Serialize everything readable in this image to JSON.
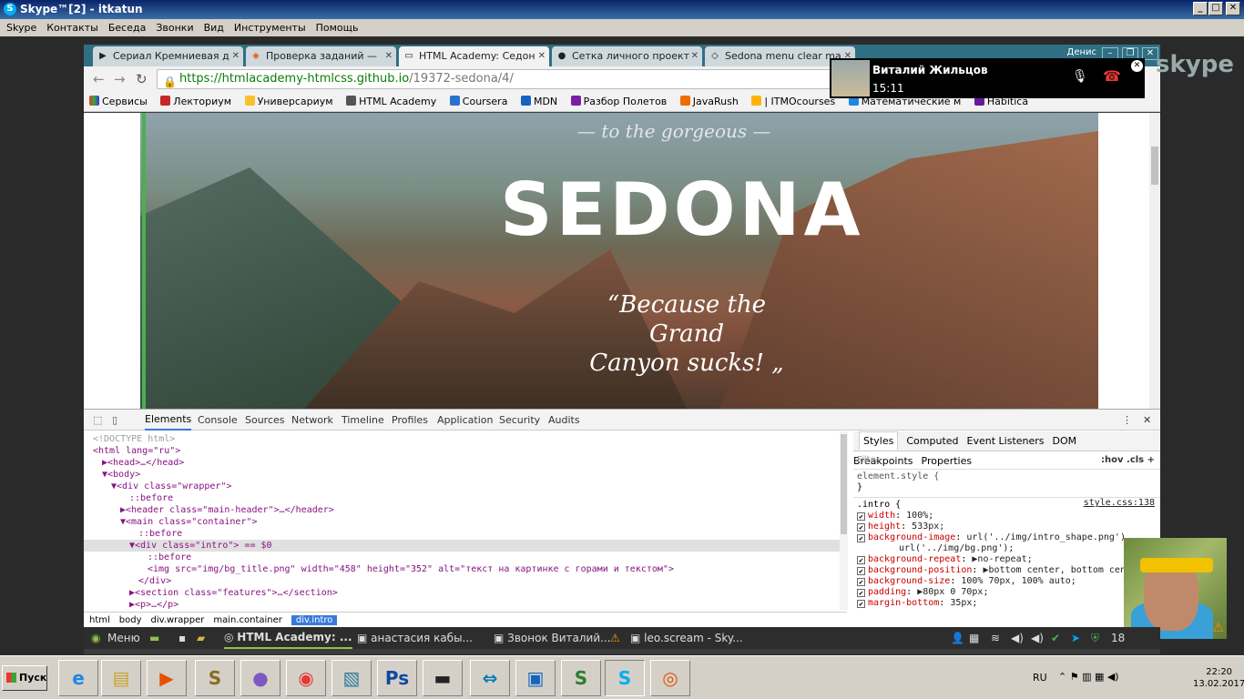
{
  "skype": {
    "title": "Skype™[2] - itkatun",
    "menu": [
      "Skype",
      "Контакты",
      "Беседа",
      "Звонки",
      "Вид",
      "Инструменты",
      "Помощь"
    ],
    "logo_text": "skype"
  },
  "browser": {
    "profile": "Денис",
    "tabs": [
      {
        "label": "Сериал Кремниевая д",
        "icon": "play-icon"
      },
      {
        "label": "Проверка заданий —",
        "icon": "check-icon"
      },
      {
        "label": "HTML Academy: Седон",
        "icon": "page-icon"
      },
      {
        "label": "Сетка личного проект",
        "icon": "github-icon"
      },
      {
        "label": "Sedona menu clear ma",
        "icon": "codepen-icon"
      }
    ],
    "url_secure": "https://htmlacademy-htmlcss.github.io",
    "url_rest": "/19372-sedona/4/",
    "bookmarks": [
      "Сервисы",
      "Лекториум",
      "Универсариум",
      "HTML Academy",
      "Coursera",
      "MDN",
      "Разбор Полетов",
      "JavaRush",
      "| ITMOcourses",
      "Математические м",
      "Habitica"
    ]
  },
  "page": {
    "tagline": "— to the gorgeous —",
    "title": "SEDONA",
    "quote_line1": "“Because the Grand",
    "quote_line2": "Canyon sucks! „"
  },
  "devtools": {
    "tabs": [
      "Elements",
      "Console",
      "Sources",
      "Network",
      "Timeline",
      "Profiles",
      "Application",
      "Security",
      "Audits"
    ],
    "active_tab": "Elements",
    "dom_lines": [
      {
        "html": "<!DOCTYPE html>",
        "kind": "comment",
        "indent": 0
      },
      {
        "html": "<html lang=\"ru\">",
        "kind": "tag",
        "indent": 0
      },
      {
        "html": "▶<head>…</head>",
        "kind": "tag",
        "indent": 1
      },
      {
        "html": "▼<body>",
        "kind": "tag",
        "indent": 1
      },
      {
        "html": "▼<div class=\"wrapper\">",
        "kind": "tag",
        "indent": 2
      },
      {
        "html": "::before",
        "kind": "pseudo",
        "indent": 4
      },
      {
        "html": "▶<header class=\"main-header\">…</header>",
        "kind": "tag",
        "indent": 3
      },
      {
        "html": "▼<main class=\"container\">",
        "kind": "tag",
        "indent": 3
      },
      {
        "html": "::before",
        "kind": "pseudo",
        "indent": 5
      },
      {
        "html": "▼<div class=\"intro\"> == $0",
        "kind": "tag",
        "indent": 4,
        "selected": true
      },
      {
        "html": "::before",
        "kind": "pseudo",
        "indent": 6
      },
      {
        "html": "<img src=\"img/bg_title.png\" width=\"458\" height=\"352\" alt=\"текст на картинке с горами и текстом\">",
        "kind": "tag",
        "indent": 6
      },
      {
        "html": "</div>",
        "kind": "tag",
        "indent": 5
      },
      {
        "html": "▶<section class=\"features\">…</section>",
        "kind": "tag",
        "indent": 4
      },
      {
        "html": "▶<p>…</p>",
        "kind": "tag",
        "indent": 4
      }
    ],
    "breadcrumbs": [
      "html",
      "body",
      "div.wrapper",
      "main.container",
      "div.intro"
    ],
    "styles_tabs": [
      "Styles",
      "Computed",
      "Event Listeners",
      "DOM Breakpoints",
      "Properties"
    ],
    "filter_placeholder": "Filter",
    "filter_buttons": ":hov  .cls  +",
    "element_style": "element.style {",
    "element_style_close": "}",
    "rule_selector": ".intro {",
    "rule_source": "style.css:138",
    "declarations": [
      {
        "prop": "width",
        "value": "100%;"
      },
      {
        "prop": "height",
        "value": "533px;"
      },
      {
        "prop": "background-image",
        "value": "url('../img/intro_shape.png'),"
      },
      {
        "prop": "",
        "value": "url('../img/bg.png');"
      },
      {
        "prop": "background-repeat",
        "value": "▶no-repeat;"
      },
      {
        "prop": "background-position",
        "value": "▶bottom center, bottom cente"
      },
      {
        "prop": "background-size",
        "value": "100% 70px, 100% auto;"
      },
      {
        "prop": "padding",
        "value": "▶80px 0 70px;"
      },
      {
        "prop": "margin-bottom",
        "value": "35px;"
      }
    ]
  },
  "call": {
    "name": "Виталий Жильцов",
    "time": "15:11"
  },
  "panel": {
    "menu": "Меню",
    "windows": [
      "HTML Academy: ...",
      "анастасия кабы...",
      "Звонок Виталий...",
      "leo.scream - Sky..."
    ],
    "tray_num": "18"
  },
  "taskbar": {
    "start": "Пуск",
    "lang": "RU",
    "time": "22:20",
    "date": "13.02.2017"
  }
}
